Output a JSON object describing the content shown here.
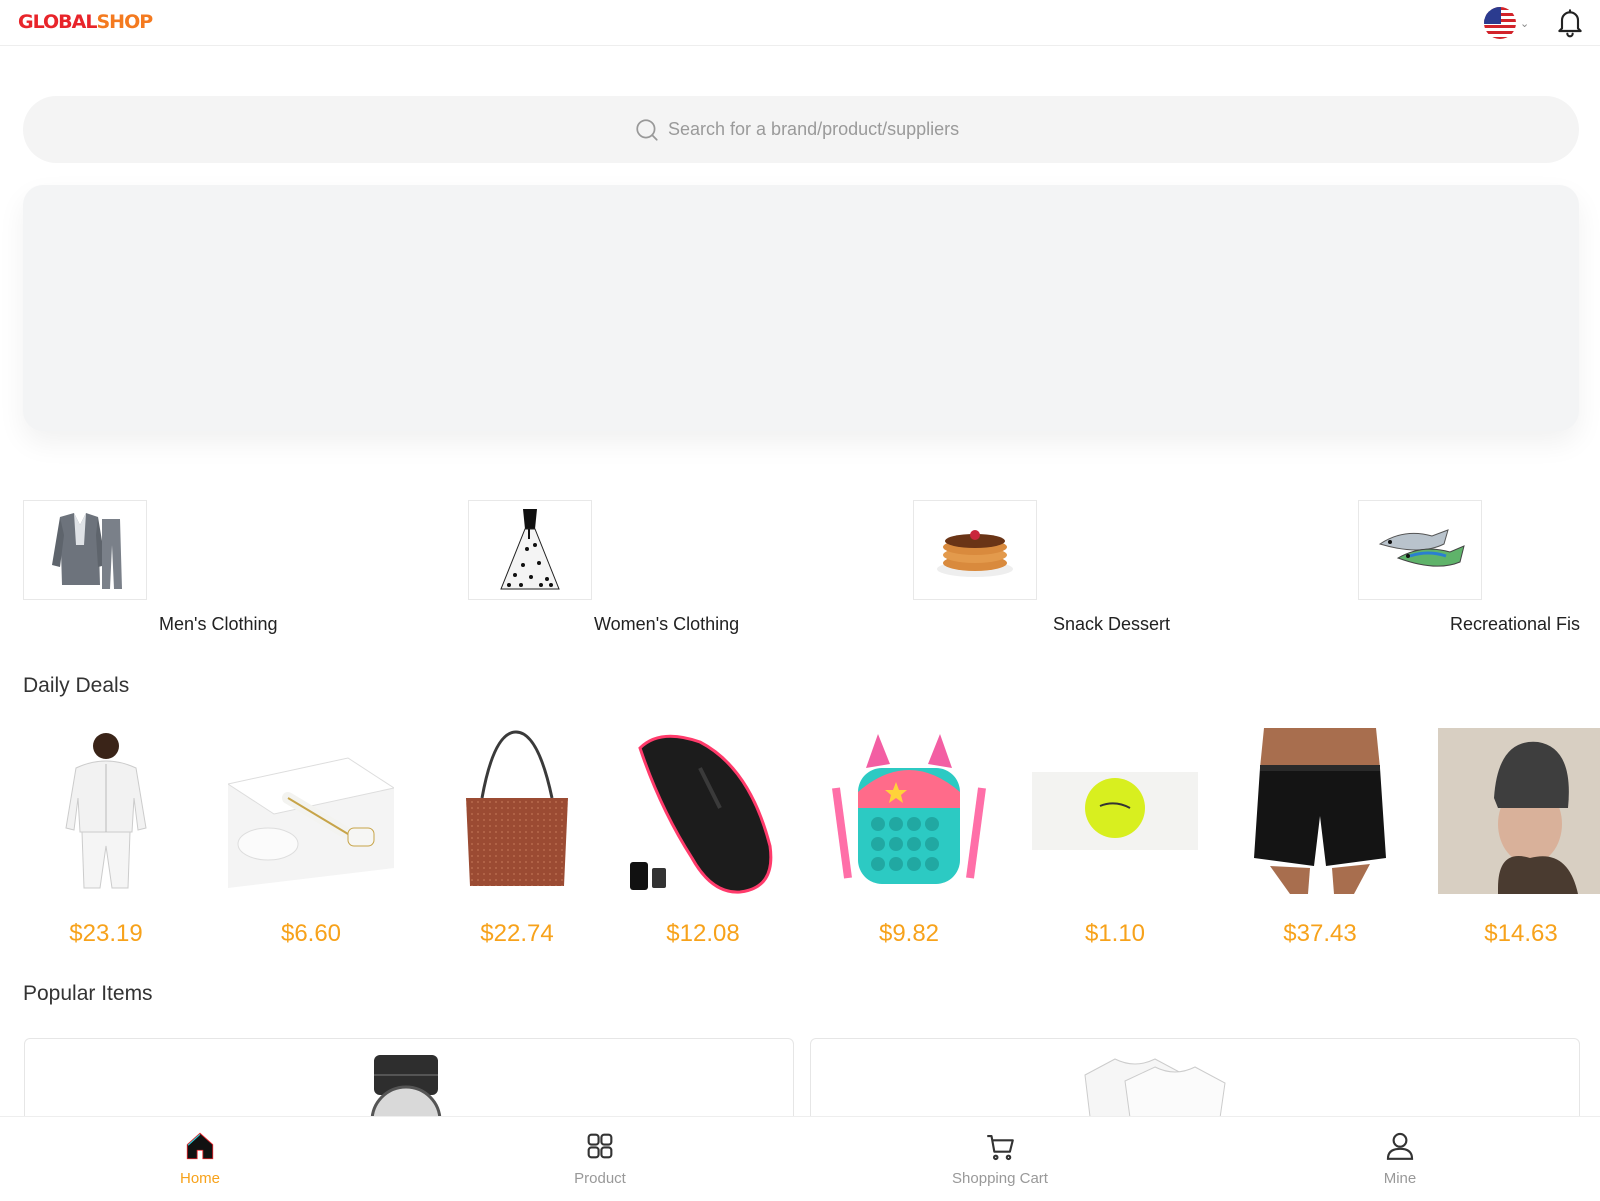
{
  "header": {
    "logo_part1": "GLOBAL",
    "logo_part2": "SHOP",
    "language_flag": "us-flag-icon",
    "notification_icon": "bell-icon"
  },
  "search": {
    "placeholder": "Search for a brand/product/suppliers",
    "icon": "search-icon"
  },
  "categories": [
    {
      "label": "Men's Clothing",
      "icon": "suit-image"
    },
    {
      "label": "Women's Clothing",
      "icon": "dress-image"
    },
    {
      "label": "Snack Dessert",
      "icon": "pancake-image"
    },
    {
      "label": "Recreational Fis",
      "icon": "fishing-lure-image"
    }
  ],
  "daily_deals": {
    "title": "Daily Deals",
    "items": [
      {
        "price": "$23.19",
        "image": "white-tracksuit"
      },
      {
        "price": "$6.60",
        "image": "jade-roller"
      },
      {
        "price": "$22.74",
        "image": "brown-handbag"
      },
      {
        "price": "$12.08",
        "image": "wireless-mouse"
      },
      {
        "price": "$9.82",
        "image": "unicorn-pop-bag"
      },
      {
        "price": "$1.10",
        "image": "golf-ball"
      },
      {
        "price": "$37.43",
        "image": "black-shorts"
      },
      {
        "price": "$14.63",
        "image": "knit-beanie"
      }
    ]
  },
  "popular_items": {
    "title": "Popular Items"
  },
  "tabbar": {
    "home": "Home",
    "product": "Product",
    "cart": "Shopping Cart",
    "mine": "Mine"
  },
  "colors": {
    "accent": "#f7a21b",
    "logo_red": "#e8242a",
    "logo_orange": "#f47a1f"
  }
}
